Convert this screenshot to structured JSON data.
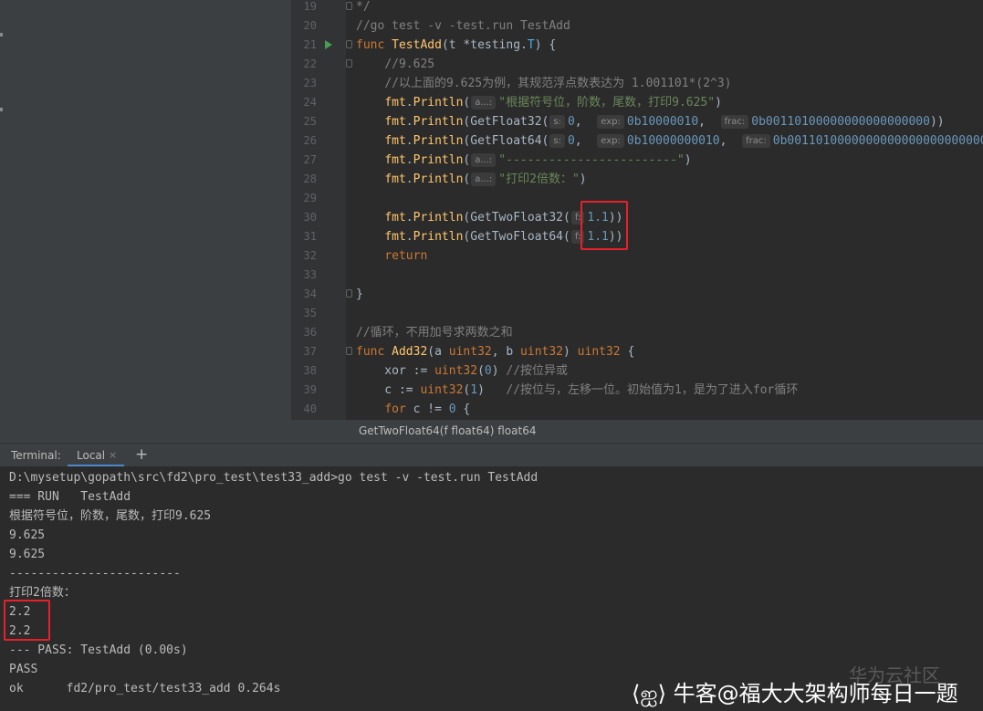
{
  "editor": {
    "lines": [
      {
        "num": "19",
        "code": "<span class=\"cm\">*/</span>"
      },
      {
        "num": "20",
        "code": "<span class=\"cm\">//go test -v -test.run TestAdd</span>"
      },
      {
        "num": "21",
        "run": true,
        "code": "<span class=\"kw\">func </span><span class=\"fn\">TestAdd</span>(t *testing.<span class=\"tq\">T</span>) {"
      },
      {
        "num": "22",
        "code": "    <span class=\"cm\">//9.625</span>"
      },
      {
        "num": "23",
        "code": "    <span class=\"cm\">//以上面的9.625为例，其规范浮点数表达为 1.001101*(2^3)</span>"
      },
      {
        "num": "24",
        "code": "    <span class=\"pk\">fmt</span>.<span class=\"pk\">Println</span>(<span class=\"hint\">a...:</span><span class=\"st\">\"根据符号位，阶数，尾数，打印9.625\"</span>)"
      },
      {
        "num": "25",
        "code": "    <span class=\"pk\">fmt</span>.<span class=\"pk\">Println</span>(GetFloat32(<span class=\"hint\">s:</span><span class=\"nm\">0</span>,  <span class=\"hint\">exp:</span><span class=\"nm\">0b10000010</span>,  <span class=\"hint\">frac:</span><span class=\"nm\">0b00110100000000000000000</span>))"
      },
      {
        "num": "26",
        "code": "    <span class=\"pk\">fmt</span>.<span class=\"pk\">Println</span>(GetFloat64(<span class=\"hint\">s:</span><span class=\"nm\">0</span>,  <span class=\"hint\">exp:</span><span class=\"nm\">0b10000000010</span>,  <span class=\"hint\">frac:</span><span class=\"nm\">0b0011010000000000000000000000000</span>"
      },
      {
        "num": "27",
        "code": "    <span class=\"pk\">fmt</span>.<span class=\"pk\">Println</span>(<span class=\"hint\">a...:</span><span class=\"st\">\"------------------------\"</span>)"
      },
      {
        "num": "28",
        "code": "    <span class=\"pk\">fmt</span>.<span class=\"pk\">Println</span>(<span class=\"hint\">a...:</span><span class=\"st\">\"打印2倍数：\"</span>)"
      },
      {
        "num": "29",
        "code": ""
      },
      {
        "num": "30",
        "code": "    <span class=\"pk\">fmt</span>.<span class=\"pk\">Println</span>(GetTwoFloat32(<span class=\"hint\">f:</span><span class=\"nm\">1.1</span>))"
      },
      {
        "num": "31",
        "code": "    <span class=\"pk\">fmt</span>.<span class=\"pk\">Println</span>(GetTwoFloat64(<span class=\"hint\">f:</span><span class=\"nm\">1.1</span>))"
      },
      {
        "num": "32",
        "code": "    <span class=\"kw\">return</span>"
      },
      {
        "num": "33",
        "code": ""
      },
      {
        "num": "34",
        "code": "}"
      },
      {
        "num": "35",
        "code": ""
      },
      {
        "num": "36",
        "code": "<span class=\"cm\">//循环，不用加号求两数之和</span>"
      },
      {
        "num": "37",
        "code": "<span class=\"kw\">func </span><span class=\"fn\">Add32</span>(a <span class=\"ty\">uint32</span>, b <span class=\"ty\">uint32</span>) <span class=\"ty\">uint32</span> {"
      },
      {
        "num": "38",
        "code": "    xor := <span class=\"ty\">uint32</span>(<span class=\"nm\">0</span>) <span class=\"cm\">//按位异或</span>"
      },
      {
        "num": "39",
        "code": "    c := <span class=\"ty\">uint32</span>(<span class=\"nm\">1</span>)   <span class=\"cm\">//按位与，左移一位。初始值为1，是为了进入for循环</span>"
      },
      {
        "num": "40",
        "code": "    <span class=\"kw\">for</span> c != <span class=\"nm\">0</span> {"
      }
    ]
  },
  "tooltip": "GetTwoFloat64(f float64) float64",
  "terminal": {
    "title": "Terminal:",
    "tab_label": "Local",
    "close_glyph": "×",
    "add_glyph": "+",
    "lines": [
      "D:\\mysetup\\gopath\\src\\fd2\\pro_test\\test33_add>go test -v -test.run TestAdd",
      "=== RUN   TestAdd",
      "根据符号位，阶数，尾数，打印9.625",
      "9.625",
      "9.625",
      "------------------------",
      "打印2倍数：",
      "2.2",
      "2.2",
      "--- PASS: TestAdd (0.00s)",
      "PASS",
      "ok      fd2/pro_test/test33_add 0.264s"
    ]
  },
  "watermark": {
    "faint": "华为云社区",
    "main": "⟨ஐ⟩ 牛客@福大大架构师每日一题"
  },
  "colors": {
    "highlight_box": "#e8202a",
    "keyword": "#cc7832",
    "string": "#6a8759",
    "number": "#6897bb",
    "function": "#ffc66d",
    "comment": "#808080"
  }
}
